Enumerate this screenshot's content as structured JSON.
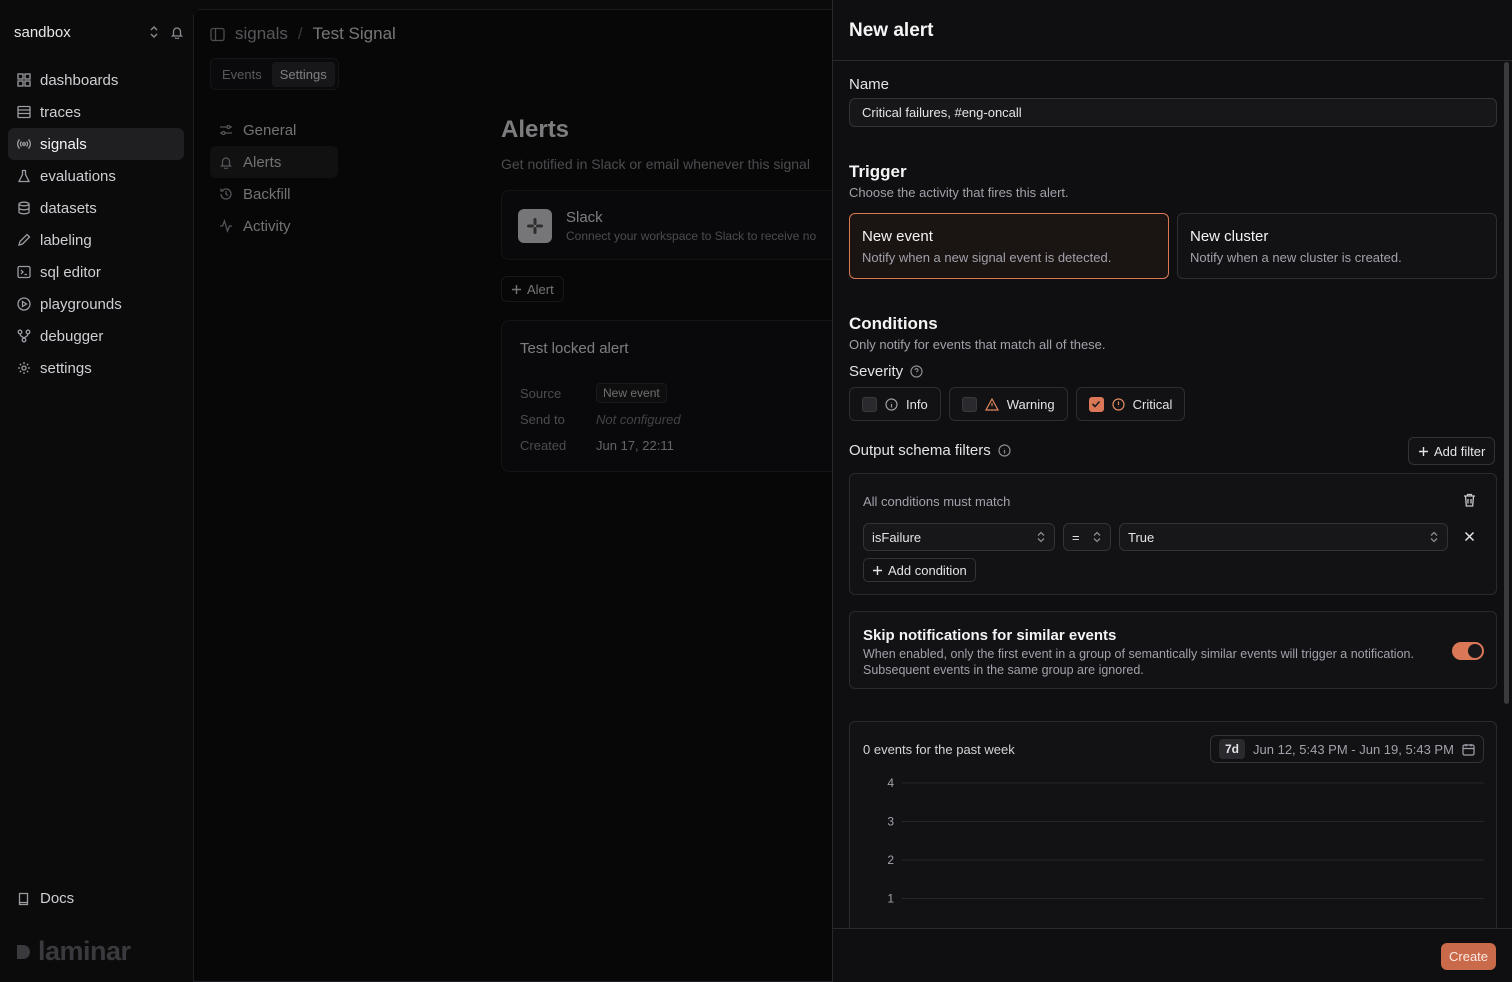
{
  "workspace": {
    "name": "sandbox"
  },
  "sidebar": {
    "items": [
      {
        "label": "dashboards",
        "icon": "grid-icon"
      },
      {
        "label": "traces",
        "icon": "table-icon"
      },
      {
        "label": "signals",
        "icon": "signal-icon",
        "active": true
      },
      {
        "label": "evaluations",
        "icon": "flask-icon"
      },
      {
        "label": "datasets",
        "icon": "database-icon"
      },
      {
        "label": "labeling",
        "icon": "pen-icon"
      },
      {
        "label": "sql editor",
        "icon": "terminal-icon"
      },
      {
        "label": "playgrounds",
        "icon": "play-icon"
      },
      {
        "label": "debugger",
        "icon": "nodes-icon"
      },
      {
        "label": "settings",
        "icon": "gear-icon"
      }
    ],
    "docs": "Docs",
    "logo": "laminar"
  },
  "header": {
    "breadcrumb_parent": "signals",
    "breadcrumb_sep": "/",
    "breadcrumb_current": "Test Signal",
    "tabs": [
      {
        "label": "Events"
      },
      {
        "label": "Settings",
        "active": true
      }
    ]
  },
  "subnav": {
    "items": [
      {
        "label": "General"
      },
      {
        "label": "Alerts",
        "active": true
      },
      {
        "label": "Backfill"
      },
      {
        "label": "Activity"
      }
    ]
  },
  "alerts_page": {
    "title": "Alerts",
    "description": "Get notified in Slack or email whenever this signal",
    "slack_name": "Slack",
    "slack_desc": "Connect your workspace to Slack to receive no",
    "add_alert": "Alert",
    "locked": {
      "title": "Test locked alert",
      "source_label": "Source",
      "source_value": "New event",
      "send_label": "Send to",
      "send_value": "Not configured",
      "created_label": "Created",
      "created_value": "Jun 17, 22:11"
    }
  },
  "drawer": {
    "title": "New alert",
    "name_label": "Name",
    "name_value": "Critical failures, #eng-oncall",
    "trigger_title": "Trigger",
    "trigger_desc": "Choose the activity that fires this alert.",
    "triggers": [
      {
        "title": "New event",
        "desc": "Notify when a new signal event is detected.",
        "selected": true
      },
      {
        "title": "New cluster",
        "desc": "Notify when a new cluster is created.",
        "selected": false
      }
    ],
    "conditions_title": "Conditions",
    "conditions_desc": "Only notify for events that match all of these.",
    "severity_label": "Severity",
    "severities": [
      {
        "label": "Info",
        "checked": false
      },
      {
        "label": "Warning",
        "checked": false
      },
      {
        "label": "Critical",
        "checked": true
      }
    ],
    "filters_label": "Output schema filters",
    "add_filter": "Add filter",
    "filter_box": {
      "label": "All conditions must match",
      "field": "isFailure",
      "operator": "=",
      "value": "True",
      "add_condition": "Add condition"
    },
    "skip": {
      "title": "Skip notifications for similar events",
      "desc": "When enabled, only the first event in a group of semantically similar events will trigger a notification. Subsequent events in the same group are ignored.",
      "enabled": true
    },
    "chart_header": {
      "count_text": "0 events for the past week",
      "range_tag": "7d",
      "range_text": "Jun 12, 5:43 PM - Jun 19, 5:43 PM"
    },
    "create": "Create"
  },
  "colors": {
    "accent": "#d97757",
    "bg": "#0f0f11"
  },
  "chart_data": {
    "type": "bar",
    "x": [],
    "values": [],
    "yticks": [
      4,
      3,
      2,
      1
    ],
    "ylim": [
      0,
      4
    ],
    "grid": true
  }
}
